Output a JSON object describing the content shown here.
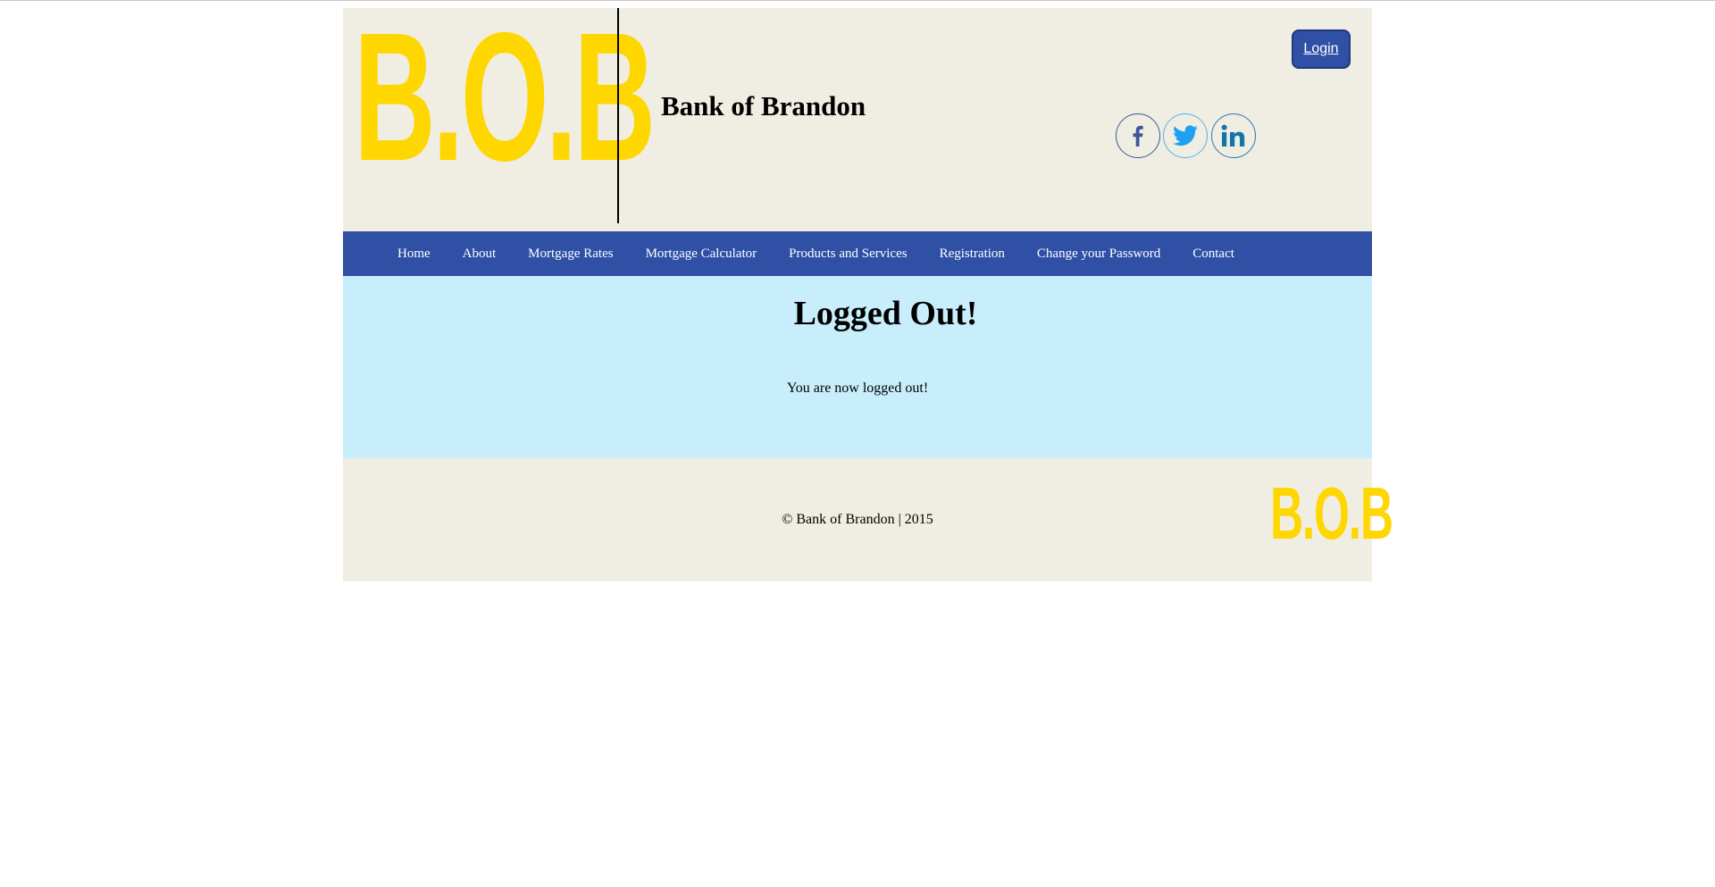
{
  "header": {
    "logo_text": "B.O.B",
    "site_title": "Bank of Brandon",
    "login_label": "Login",
    "social": [
      {
        "name": "facebook",
        "icon": "facebook-icon",
        "color": "#3b5998"
      },
      {
        "name": "twitter",
        "icon": "twitter-icon",
        "color": "#1da1f2"
      },
      {
        "name": "linkedin",
        "icon": "linkedin-icon",
        "color": "#0e76a8"
      }
    ]
  },
  "nav": {
    "items": [
      {
        "label": "Home"
      },
      {
        "label": "About"
      },
      {
        "label": "Mortgage Rates"
      },
      {
        "label": "Mortgage Calculator"
      },
      {
        "label": "Products and Services"
      },
      {
        "label": "Registration"
      },
      {
        "label": "Change your Password"
      },
      {
        "label": "Contact"
      }
    ]
  },
  "main": {
    "heading": "Logged Out!",
    "message": "You are now logged out!"
  },
  "footer": {
    "copyright": "© Bank of Brandon | 2015",
    "logo_text": "B.O.B"
  },
  "colors": {
    "brand_blue": "#2f50a5",
    "logo_yellow": "#ffd700",
    "header_bg": "#f0ede3",
    "content_bg": "#c8eefc"
  }
}
